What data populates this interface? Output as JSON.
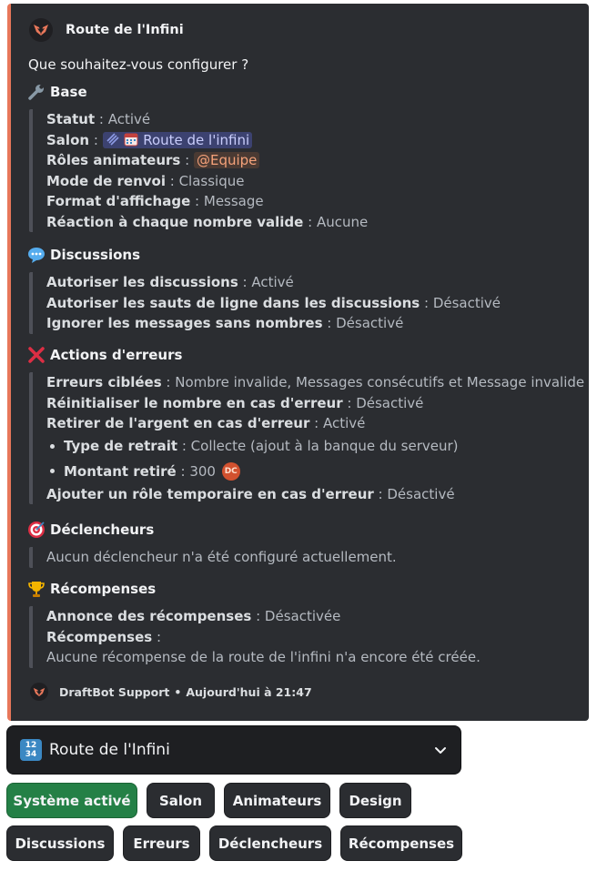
{
  "embed": {
    "accent": "#e8775a",
    "author": "Route de l'Infini",
    "description": "Que souhaitez-vous configurer ?",
    "base": {
      "title": "Base",
      "emoji": "wrench-icon",
      "statut_label": "Statut",
      "statut_value": "Activé",
      "salon_label": "Salon",
      "salon_value": "Route de l'infini",
      "roles_label": "Rôles animateurs",
      "roles_value": "@Equipe",
      "mode_label": "Mode de renvoi",
      "mode_value": "Classique",
      "format_label": "Format d'affichage",
      "format_value": "Message",
      "reaction_label": "Réaction à chaque nombre valide",
      "reaction_value": "Aucune"
    },
    "discussions": {
      "title": "Discussions",
      "emoji": "speech-bubble-icon",
      "allow_label": "Autoriser les discussions",
      "allow_value": "Activé",
      "linebreak_label": "Autoriser les sauts de ligne dans les discussions",
      "linebreak_value": "Désactivé",
      "ignore_label": "Ignorer les messages sans nombres",
      "ignore_value": "Désactivé"
    },
    "errors": {
      "title": "Actions d'erreurs",
      "emoji": "red-x-icon",
      "targeted_label": "Erreurs ciblées",
      "targeted_value": "Nombre invalide, Messages consécutifs et Message invalide",
      "reset_label": "Réinitialiser le nombre en cas d'erreur",
      "reset_value": "Désactivé",
      "money_label": "Retirer de l'argent en cas d'erreur",
      "money_value": "Activé",
      "type_label": "Type de retrait",
      "type_value": "Collecte (ajout à la banque du serveur)",
      "amount_label": "Montant retiré",
      "amount_value": "300",
      "temprole_label": "Ajouter un rôle temporaire en cas d'erreur",
      "temprole_value": "Désactivé"
    },
    "triggers": {
      "title": "Déclencheurs",
      "emoji": "target-icon",
      "text": "Aucun déclencheur n'a été configuré actuellement."
    },
    "rewards": {
      "title": "Récompenses",
      "emoji": "trophy-icon",
      "announce_label": "Annonce des récompenses",
      "announce_value": "Désactivée",
      "list_label": "Récompenses",
      "list_value": "",
      "none_text": "Aucune récompense de la route de l'infini n'a encore été créée."
    },
    "footer": {
      "bot": "DraftBot Support",
      "separator": "•",
      "time": "Aujourd'hui à 21:47"
    }
  },
  "select": {
    "icon": "keycap-1234-icon",
    "label": "Route de l'Infini"
  },
  "buttons": {
    "system": "Système activé",
    "salon": "Salon",
    "animateurs": "Animateurs",
    "design": "Design",
    "discussions": "Discussions",
    "erreurs": "Erreurs",
    "declencheurs": "Déclencheurs",
    "recompenses": "Récompenses"
  }
}
